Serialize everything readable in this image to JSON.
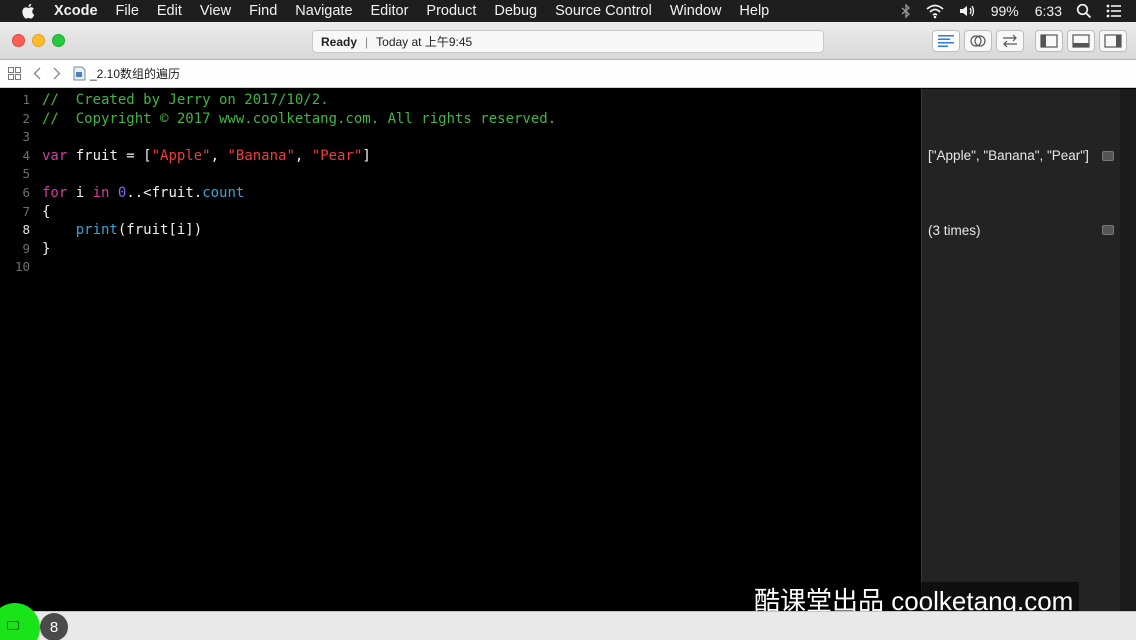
{
  "menubar": {
    "app": "Xcode",
    "items": [
      "File",
      "Edit",
      "View",
      "Find",
      "Navigate",
      "Editor",
      "Product",
      "Debug",
      "Source Control",
      "Window",
      "Help"
    ],
    "battery": "99%",
    "time": "6:33"
  },
  "toolbar": {
    "status": "Ready",
    "activity": "Today at 上午9:45"
  },
  "jumpbar": {
    "filename": "_2.10数组的遍历"
  },
  "editor": {
    "current_line": 8,
    "lines": [
      {
        "num": "1",
        "tokens": [
          {
            "t": "comment",
            "v": "//  Created by Jerry on 2017/10/2."
          }
        ]
      },
      {
        "num": "2",
        "tokens": [
          {
            "t": "comment",
            "v": "//  Copyright © 2017 www.coolketang.com. All rights reserved."
          }
        ]
      },
      {
        "num": "3",
        "tokens": []
      },
      {
        "num": "4",
        "tokens": [
          {
            "t": "kw",
            "v": "var"
          },
          {
            "t": "plain",
            "v": " fruit = ["
          },
          {
            "t": "str",
            "v": "\"Apple\""
          },
          {
            "t": "plain",
            "v": ", "
          },
          {
            "t": "str",
            "v": "\"Banana\""
          },
          {
            "t": "plain",
            "v": ", "
          },
          {
            "t": "str",
            "v": "\"Pear\""
          },
          {
            "t": "plain",
            "v": "]"
          }
        ]
      },
      {
        "num": "5",
        "tokens": []
      },
      {
        "num": "6",
        "tokens": [
          {
            "t": "kw",
            "v": "for"
          },
          {
            "t": "plain",
            "v": " i "
          },
          {
            "t": "kw",
            "v": "in"
          },
          {
            "t": "plain",
            "v": " "
          },
          {
            "t": "num",
            "v": "0"
          },
          {
            "t": "plain",
            "v": "..<fruit."
          },
          {
            "t": "func",
            "v": "count"
          }
        ]
      },
      {
        "num": "7",
        "tokens": [
          {
            "t": "plain",
            "v": "{"
          }
        ]
      },
      {
        "num": "8",
        "tokens": [
          {
            "t": "plain",
            "v": "    "
          },
          {
            "t": "func",
            "v": "print"
          },
          {
            "t": "plain",
            "v": "(fruit[i])"
          }
        ]
      },
      {
        "num": "9",
        "tokens": [
          {
            "t": "plain",
            "v": "}"
          }
        ]
      },
      {
        "num": "10",
        "tokens": []
      }
    ]
  },
  "results": [
    {
      "line": 4,
      "text": "[\"Apple\", \"Banana\", \"Pear\"]"
    },
    {
      "line": 8,
      "text": "(3 times)"
    }
  ],
  "watermark": "酷课堂出品 coolketang.com",
  "debug": {
    "badge": "8"
  },
  "colors": {
    "comment": "#41b645",
    "keyword": "#d33ba0",
    "string": "#ef3d3d",
    "number": "#7e6bf0",
    "function": "#3aa1d6"
  }
}
